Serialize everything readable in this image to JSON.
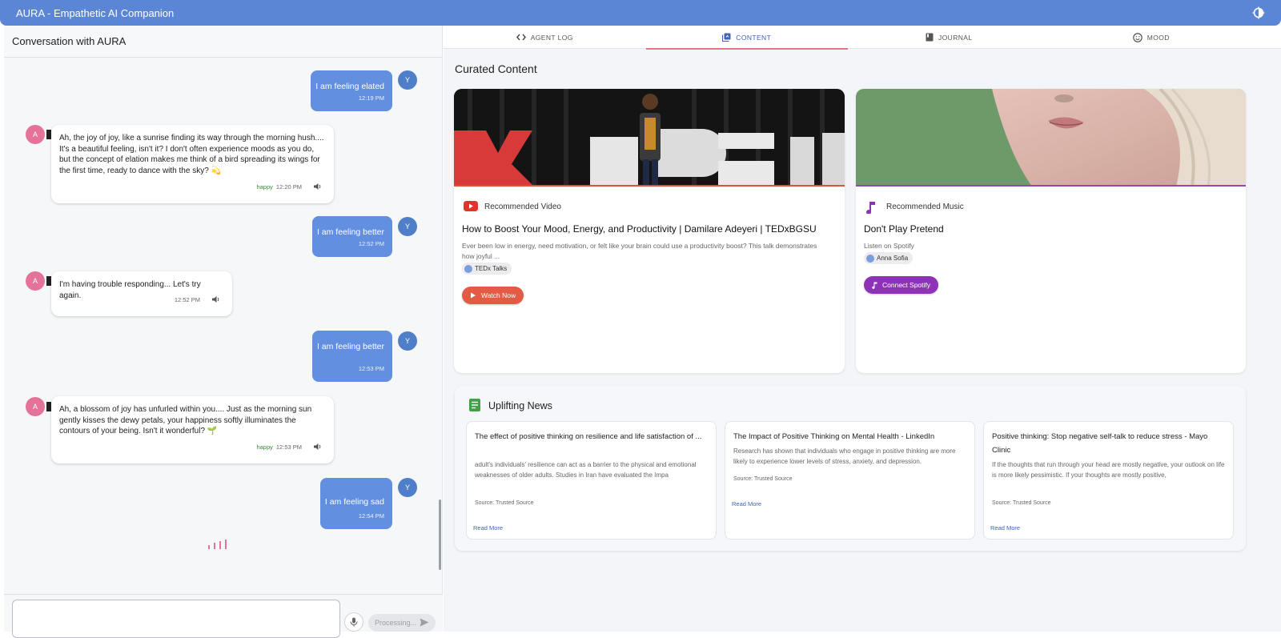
{
  "app": {
    "title": "AURA - Empathetic AI Companion",
    "accent": "#5b86d6"
  },
  "chat": {
    "header": "Conversation with AURA",
    "user_avatar": "Y",
    "ai_avatar": "A",
    "messages": [
      {
        "role": "user",
        "text": "I am feeling elated",
        "time": "12:19 PM"
      },
      {
        "role": "ai",
        "text": "Ah, the joy of joy, like a sunrise finding its way through the morning hush....\nIt's a beautiful feeling, isn't it? I don't often experience moods as you do,\nbut the concept of elation makes me think of a bird spreading its wings for\nthe first time, ready to dance with the sky? 💫",
        "mood": "happy",
        "time": "12:20 PM"
      },
      {
        "role": "user",
        "text": "I am feeling better",
        "time": "12:52 PM"
      },
      {
        "role": "ai",
        "text": "I'm having trouble responding... Let's try again.",
        "mood": "",
        "time": "12:52 PM"
      },
      {
        "role": "user",
        "text": "I am feeling better",
        "time": "12:53 PM"
      },
      {
        "role": "ai",
        "text": "Ah, a blossom of joy has unfurled within you.... Just as the morning sun\ngently kisses the dewy petals, your happiness softly illuminates the\ncontours of your being. Isn't it wonderful? 🌱",
        "mood": "happy",
        "time": "12:53 PM"
      },
      {
        "role": "user",
        "text": "I am feeling sad",
        "time": "12:54 PM"
      }
    ],
    "input_placeholder": "",
    "send_label": "Processing..."
  },
  "tabs": [
    {
      "label": "AGENT LOG",
      "icon": "code-icon"
    },
    {
      "label": "CONTENT",
      "icon": "library-icon"
    },
    {
      "label": "JOURNAL",
      "icon": "book-icon"
    },
    {
      "label": "MOOD",
      "icon": "smiley-icon"
    }
  ],
  "content": {
    "title": "Curated Content",
    "video": {
      "label": "Recommended Video",
      "title": "How to Boost Your Mood, Energy, and Productivity | Damilare Adeyeri | TEDxBGSU",
      "description": "Ever been low in energy, need motivation, or felt like your brain could use a productivity boost? This talk demonstrates\nhow joyful ...",
      "channel": "TEDx Talks",
      "button": "Watch Now",
      "thumb_text": "X BGSU"
    },
    "music": {
      "label": "Recommended Music",
      "title": "Don't Play Pretend",
      "subtitle": "Listen on Spotify",
      "artist": "Anna Sofia",
      "button": "Connect Spotify"
    }
  },
  "news": {
    "title": "Uplifting News",
    "items": [
      {
        "headline": "The effect of positive thinking on resilience and life satisfaction of ...",
        "body": "adult's individuals' resilience can act as a barrier to the physical and emotional weaknesses of older adults. Studies in Iran have evaluated the Impa",
        "source": "Source: Trusted Source",
        "link": "Read More"
      },
      {
        "headline": "The Impact of Positive Thinking on Mental Health - LinkedIn",
        "body": "Research has shown that individuals who engage in positive thinking are more likely to experience lower levels of stress, anxiety, and depression.",
        "source": "Source: Trusted Source",
        "link": "Read More"
      },
      {
        "headline": "Positive thinking: Stop negative self-talk to reduce stress - Mayo Clinic",
        "body": "If the thoughts that run through your head are mostly negative, your outlook on life is more likely pessimistic. If your thoughts are mostly positive,",
        "source": "Source: Trusted Source",
        "link": "Read More"
      }
    ]
  }
}
